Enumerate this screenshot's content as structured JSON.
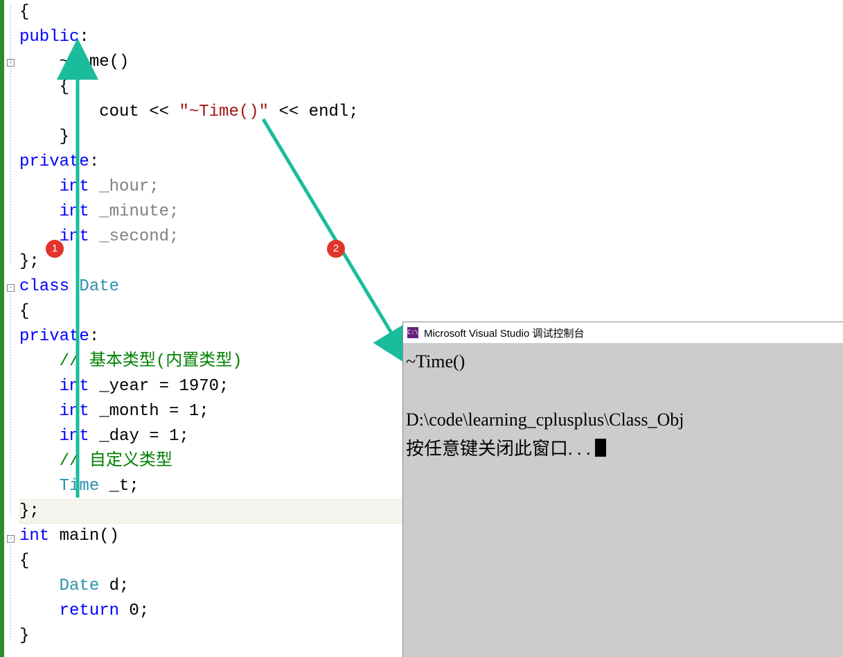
{
  "code": {
    "l1": "{",
    "l2_kw": "public",
    "l2_colon": ":",
    "l3_destructor": "~Time()",
    "l4": "{",
    "l5_cout": "cout",
    "l5_op1": " << ",
    "l5_str": "\"~Time()\"",
    "l5_op2": " << ",
    "l5_endl": "endl",
    "l5_semi": ";",
    "l6": "}",
    "l7_kw": "private",
    "l7_colon": ":",
    "l8_kw": "int",
    "l8_name": " _hour;",
    "l9_kw": "int",
    "l9_name": " _minute;",
    "l10_kw": "int",
    "l10_name": " _second;",
    "l11": "};",
    "l12_kw": "class",
    "l12_sp": " ",
    "l12_type": "Date",
    "l13": "{",
    "l14_kw": "private",
    "l14_colon": ":",
    "l15_comment": "// 基本类型(内置类型)",
    "l16_kw": "int",
    "l16_rest": " _year = 1970;",
    "l17_kw": "int",
    "l17_rest": " _month = 1;",
    "l18_kw": "int",
    "l18_rest": " _day = 1;",
    "l19_comment": "// 自定义类型",
    "l20_type": "Time",
    "l20_rest": " _t;",
    "l21": "};",
    "l22_kw": "int",
    "l22_rest": " main()",
    "l23": "{",
    "l24_type": "Date",
    "l24_rest": " d;",
    "l25_kw": "return",
    "l25_rest": " 0;",
    "l26": "}"
  },
  "badges": {
    "b1": "1",
    "b2": "2"
  },
  "console": {
    "icon": "C:\\",
    "title": "Microsoft Visual Studio 调试控制台",
    "out1": "~Time()",
    "out2": "D:\\code\\learning_cplusplus\\Class_Obj",
    "out3": "按任意键关闭此窗口. . . "
  }
}
